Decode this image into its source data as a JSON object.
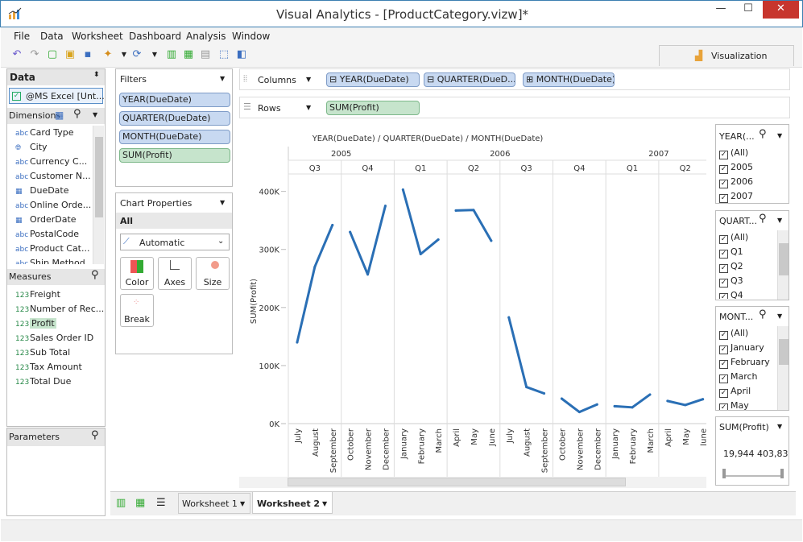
{
  "window": {
    "title": "Visual Analytics - [ProductCategory.vizw]*",
    "min": "—",
    "max": "☐",
    "close": "✕"
  },
  "menu": [
    "File",
    "Data",
    "Worksheet",
    "Dashboard",
    "Analysis",
    "Window"
  ],
  "toolbar": {
    "vis_label": "Visualization"
  },
  "data_panel": {
    "title": "Data",
    "source": "@MS Excel [Unt...",
    "dimensions_title": "Dimensions",
    "dimensions": [
      {
        "t": "abc",
        "n": "Card Type"
      },
      {
        "t": "geo",
        "n": "City"
      },
      {
        "t": "abc",
        "n": "Currency C..."
      },
      {
        "t": "abc",
        "n": "Customer N..."
      },
      {
        "t": "date",
        "n": "DueDate"
      },
      {
        "t": "abc",
        "n": "Online Orde..."
      },
      {
        "t": "date",
        "n": "OrderDate"
      },
      {
        "t": "abc",
        "n": "PostalCode"
      },
      {
        "t": "abc",
        "n": "Product Cat..."
      },
      {
        "t": "abc",
        "n": "Ship Method"
      }
    ],
    "measures_title": "Measures",
    "measures": [
      {
        "t": "123",
        "n": "Freight"
      },
      {
        "t": "123",
        "n": "Number of Rec..."
      },
      {
        "t": "123",
        "n": "Profit"
      },
      {
        "t": "123",
        "n": "Sales Order ID"
      },
      {
        "t": "123",
        "n": "Sub Total"
      },
      {
        "t": "123",
        "n": "Tax Amount"
      },
      {
        "t": "123",
        "n": "Total Due"
      }
    ],
    "parameters_title": "Parameters"
  },
  "filters": {
    "title": "Filters",
    "items": [
      "YEAR(DueDate)",
      "QUARTER(DueDate)",
      "MONTH(DueDate)",
      "SUM(Profit)"
    ]
  },
  "chart_props": {
    "title": "Chart Properties",
    "all": "All",
    "mark": "Automatic",
    "buttons": [
      "Color",
      "Axes",
      "Size",
      "Break"
    ]
  },
  "shelves": {
    "columns_label": "Columns",
    "rows_label": "Rows",
    "columns": [
      "YEAR(DueDate)",
      "QUARTER(DueD...",
      "MONTH(DueDate)"
    ],
    "rows": [
      "SUM(Profit)"
    ]
  },
  "legends": {
    "year": {
      "title": "YEAR(...",
      "items": [
        "(All)",
        "2005",
        "2006",
        "2007"
      ]
    },
    "quarter": {
      "title": "QUART...",
      "items": [
        "(All)",
        "Q1",
        "Q2",
        "Q3",
        "Q4"
      ]
    },
    "month": {
      "title": "MONT...",
      "items": [
        "(All)",
        "January",
        "February",
        "March",
        "April",
        "May"
      ]
    },
    "profit": {
      "title": "SUM(Profit)",
      "min": "19,944",
      "max": "403,83"
    }
  },
  "sheets": [
    "Worksheet 1",
    "Worksheet 2"
  ],
  "chart_data": {
    "type": "line",
    "title": "YEAR(DueDate) / QUARTER(DueDate) / MONTH(DueDate)",
    "ylabel": "SUM(Profit)",
    "ylim": [
      0,
      430000
    ],
    "yticks": [
      "0K",
      "100K",
      "200K",
      "300K",
      "400K"
    ],
    "ytick_values": [
      0,
      100000,
      200000,
      300000,
      400000
    ],
    "years": [
      {
        "label": "2005",
        "quarters": 2
      },
      {
        "label": "2006",
        "quarters": 4
      },
      {
        "label": "2007",
        "quarters": 2
      }
    ],
    "quarters": [
      {
        "label": "Q3",
        "months": [
          "July",
          "August",
          "September"
        ],
        "values": [
          140000,
          270000,
          342000
        ]
      },
      {
        "label": "Q4",
        "months": [
          "October",
          "November",
          "December"
        ],
        "values": [
          330000,
          257000,
          375000
        ]
      },
      {
        "label": "Q1",
        "months": [
          "January",
          "February",
          "March"
        ],
        "values": [
          403000,
          292000,
          317000
        ]
      },
      {
        "label": "Q2",
        "months": [
          "April",
          "May",
          "June"
        ],
        "values": [
          367000,
          368000,
          315000
        ]
      },
      {
        "label": "Q3",
        "months": [
          "July",
          "August",
          "September"
        ],
        "values": [
          183000,
          63000,
          52000
        ]
      },
      {
        "label": "Q4",
        "months": [
          "October",
          "November",
          "December"
        ],
        "values": [
          43000,
          20000,
          33000
        ]
      },
      {
        "label": "Q1",
        "months": [
          "January",
          "February",
          "March"
        ],
        "values": [
          30000,
          28000,
          50000
        ]
      },
      {
        "label": "Q2",
        "months": [
          "April",
          "May",
          "June"
        ],
        "values": [
          39000,
          32000,
          42000
        ]
      }
    ],
    "color": "#2a6fb5"
  }
}
